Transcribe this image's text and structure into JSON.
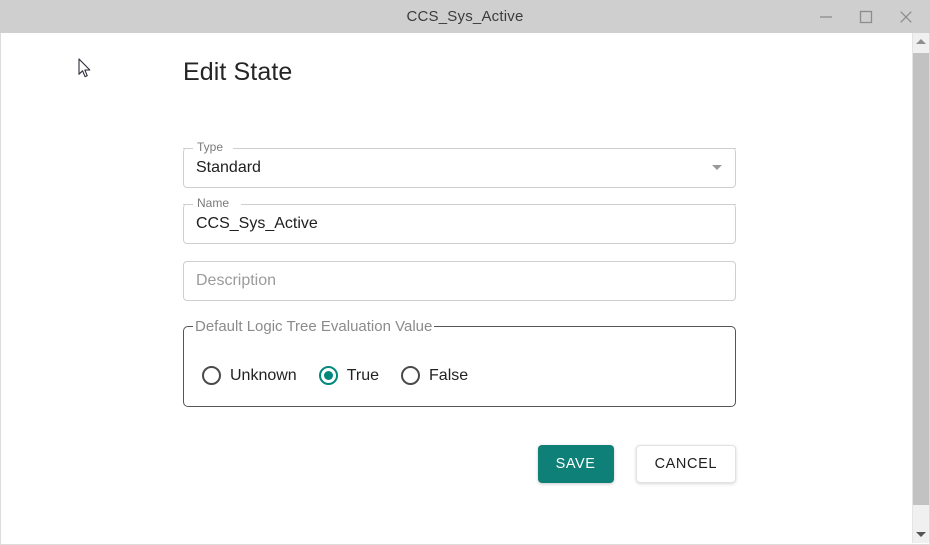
{
  "window": {
    "title": "CCS_Sys_Active",
    "controls": {
      "minimize": "minimize-icon",
      "maximize": "maximize-icon",
      "close": "close-icon"
    }
  },
  "form": {
    "heading": "Edit State",
    "fields": [
      {
        "name": "type",
        "label": "Type",
        "value": "Standard",
        "placeholder": "",
        "kind": "select",
        "icon": "chevron-down-icon"
      },
      {
        "name": "name",
        "label": "Name",
        "value": "CCS_Sys_Active",
        "placeholder": "",
        "kind": "text"
      },
      {
        "name": "description",
        "label": "",
        "value": "",
        "placeholder": "Description",
        "kind": "text"
      }
    ],
    "radio_group": {
      "legend": "Default Logic Tree Evaluation Value",
      "selected": "True",
      "options": [
        {
          "label": "Unknown",
          "selected": false
        },
        {
          "label": "True",
          "selected": true
        },
        {
          "label": "False",
          "selected": false
        }
      ]
    },
    "actions": {
      "save_label": "SAVE",
      "cancel_label": "CANCEL"
    }
  },
  "scrollbar": {
    "up_icon": "scroll-up-arrow-icon",
    "down_icon": "scroll-down-arrow-icon"
  },
  "colors": {
    "accent": "#00897b",
    "save_button": "#0e8077",
    "titlebar": "#cfcfcf",
    "field_border": "#cfcfcf",
    "group_border": "#555555"
  }
}
